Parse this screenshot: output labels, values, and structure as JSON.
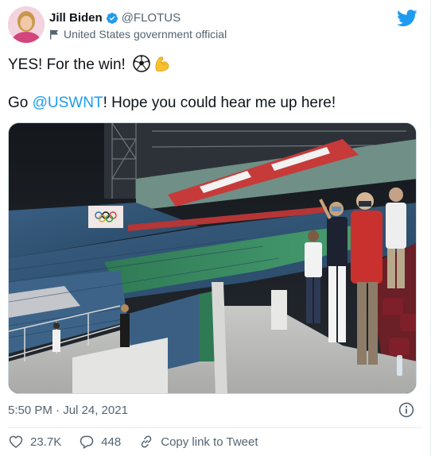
{
  "author": {
    "display_name": "Jill Biden",
    "handle": "@FLOTUS",
    "label": "United States government official",
    "avatar": "profile-photo",
    "verified_color": "#1d9bf0"
  },
  "tweet": {
    "line1_text": "YES! For the win! ",
    "line1_emojis": [
      "soccer-ball",
      "flexed-biceps"
    ],
    "line2_prefix": "Go ",
    "line2_mention": "@USWNT",
    "line2_suffix": "! Hope you could hear me up here!"
  },
  "media": {
    "type": "photo",
    "alt": "photo"
  },
  "meta": {
    "timestamp": "5:50 PM · Jul 24, 2021"
  },
  "actions": {
    "like_count": "23.7K",
    "reply_count": "448",
    "copy_link_label": "Copy link to Tweet"
  },
  "colors": {
    "brand": "#1d9bf0",
    "text": "#0f1419",
    "muted": "#536471"
  }
}
